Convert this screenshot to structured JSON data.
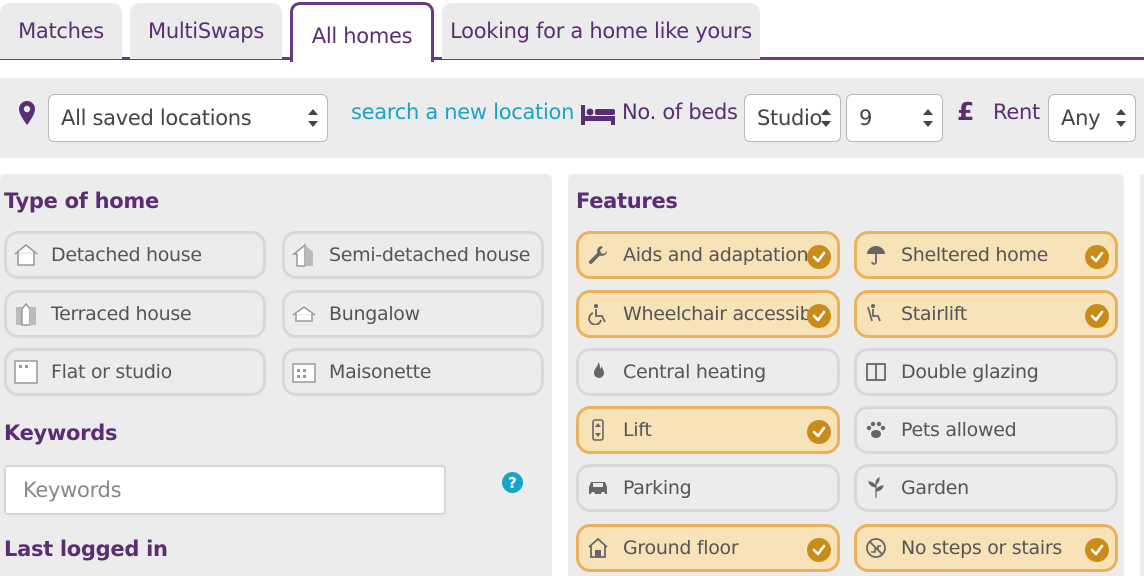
{
  "tabs": [
    {
      "label": "Matches"
    },
    {
      "label": "MultiSwaps"
    },
    {
      "label": "All homes"
    },
    {
      "label": "Looking for a home like yours"
    }
  ],
  "filters": {
    "location_value": "All saved locations",
    "search_link": "search a new location",
    "beds_label": "No. of beds",
    "beds_min": "Studio",
    "beds_max": "9",
    "rent_label": "Rent",
    "rent_value": "Any"
  },
  "type_of_home": {
    "title": "Type of home",
    "items": [
      {
        "label": "Detached house",
        "icon": "detached-house-icon"
      },
      {
        "label": "Semi-detached house",
        "icon": "semi-detached-house-icon"
      },
      {
        "label": "Terraced house",
        "icon": "terraced-house-icon"
      },
      {
        "label": "Bungalow",
        "icon": "bungalow-icon"
      },
      {
        "label": "Flat or studio",
        "icon": "flat-icon"
      },
      {
        "label": "Maisonette",
        "icon": "maisonette-icon"
      }
    ]
  },
  "keywords": {
    "title": "Keywords",
    "placeholder": "Keywords",
    "help": "?"
  },
  "last_logged_in": {
    "title": "Last logged in"
  },
  "features": {
    "title": "Features",
    "items": [
      {
        "label": "Aids and adaptations",
        "icon": "wrench-icon",
        "selected": true
      },
      {
        "label": "Sheltered home",
        "icon": "umbrella-icon",
        "selected": true
      },
      {
        "label": "Wheelchair accessible",
        "icon": "wheelchair-icon",
        "selected": true
      },
      {
        "label": "Stairlift",
        "icon": "stairlift-icon",
        "selected": true
      },
      {
        "label": "Central heating",
        "icon": "flame-icon",
        "selected": false
      },
      {
        "label": "Double glazing",
        "icon": "window-icon",
        "selected": false
      },
      {
        "label": "Lift",
        "icon": "lift-icon",
        "selected": true
      },
      {
        "label": "Pets allowed",
        "icon": "paw-icon",
        "selected": false
      },
      {
        "label": "Parking",
        "icon": "car-icon",
        "selected": false
      },
      {
        "label": "Garden",
        "icon": "plant-icon",
        "selected": false
      },
      {
        "label": "Ground floor",
        "icon": "house-icon",
        "selected": true
      },
      {
        "label": "No steps or stairs",
        "icon": "no-stairs-icon",
        "selected": true
      }
    ]
  },
  "colors": {
    "brand": "#5b2d73",
    "link": "#1aa3c9",
    "selected_bg": "#f8e2b8",
    "check": "#c98b1a"
  }
}
